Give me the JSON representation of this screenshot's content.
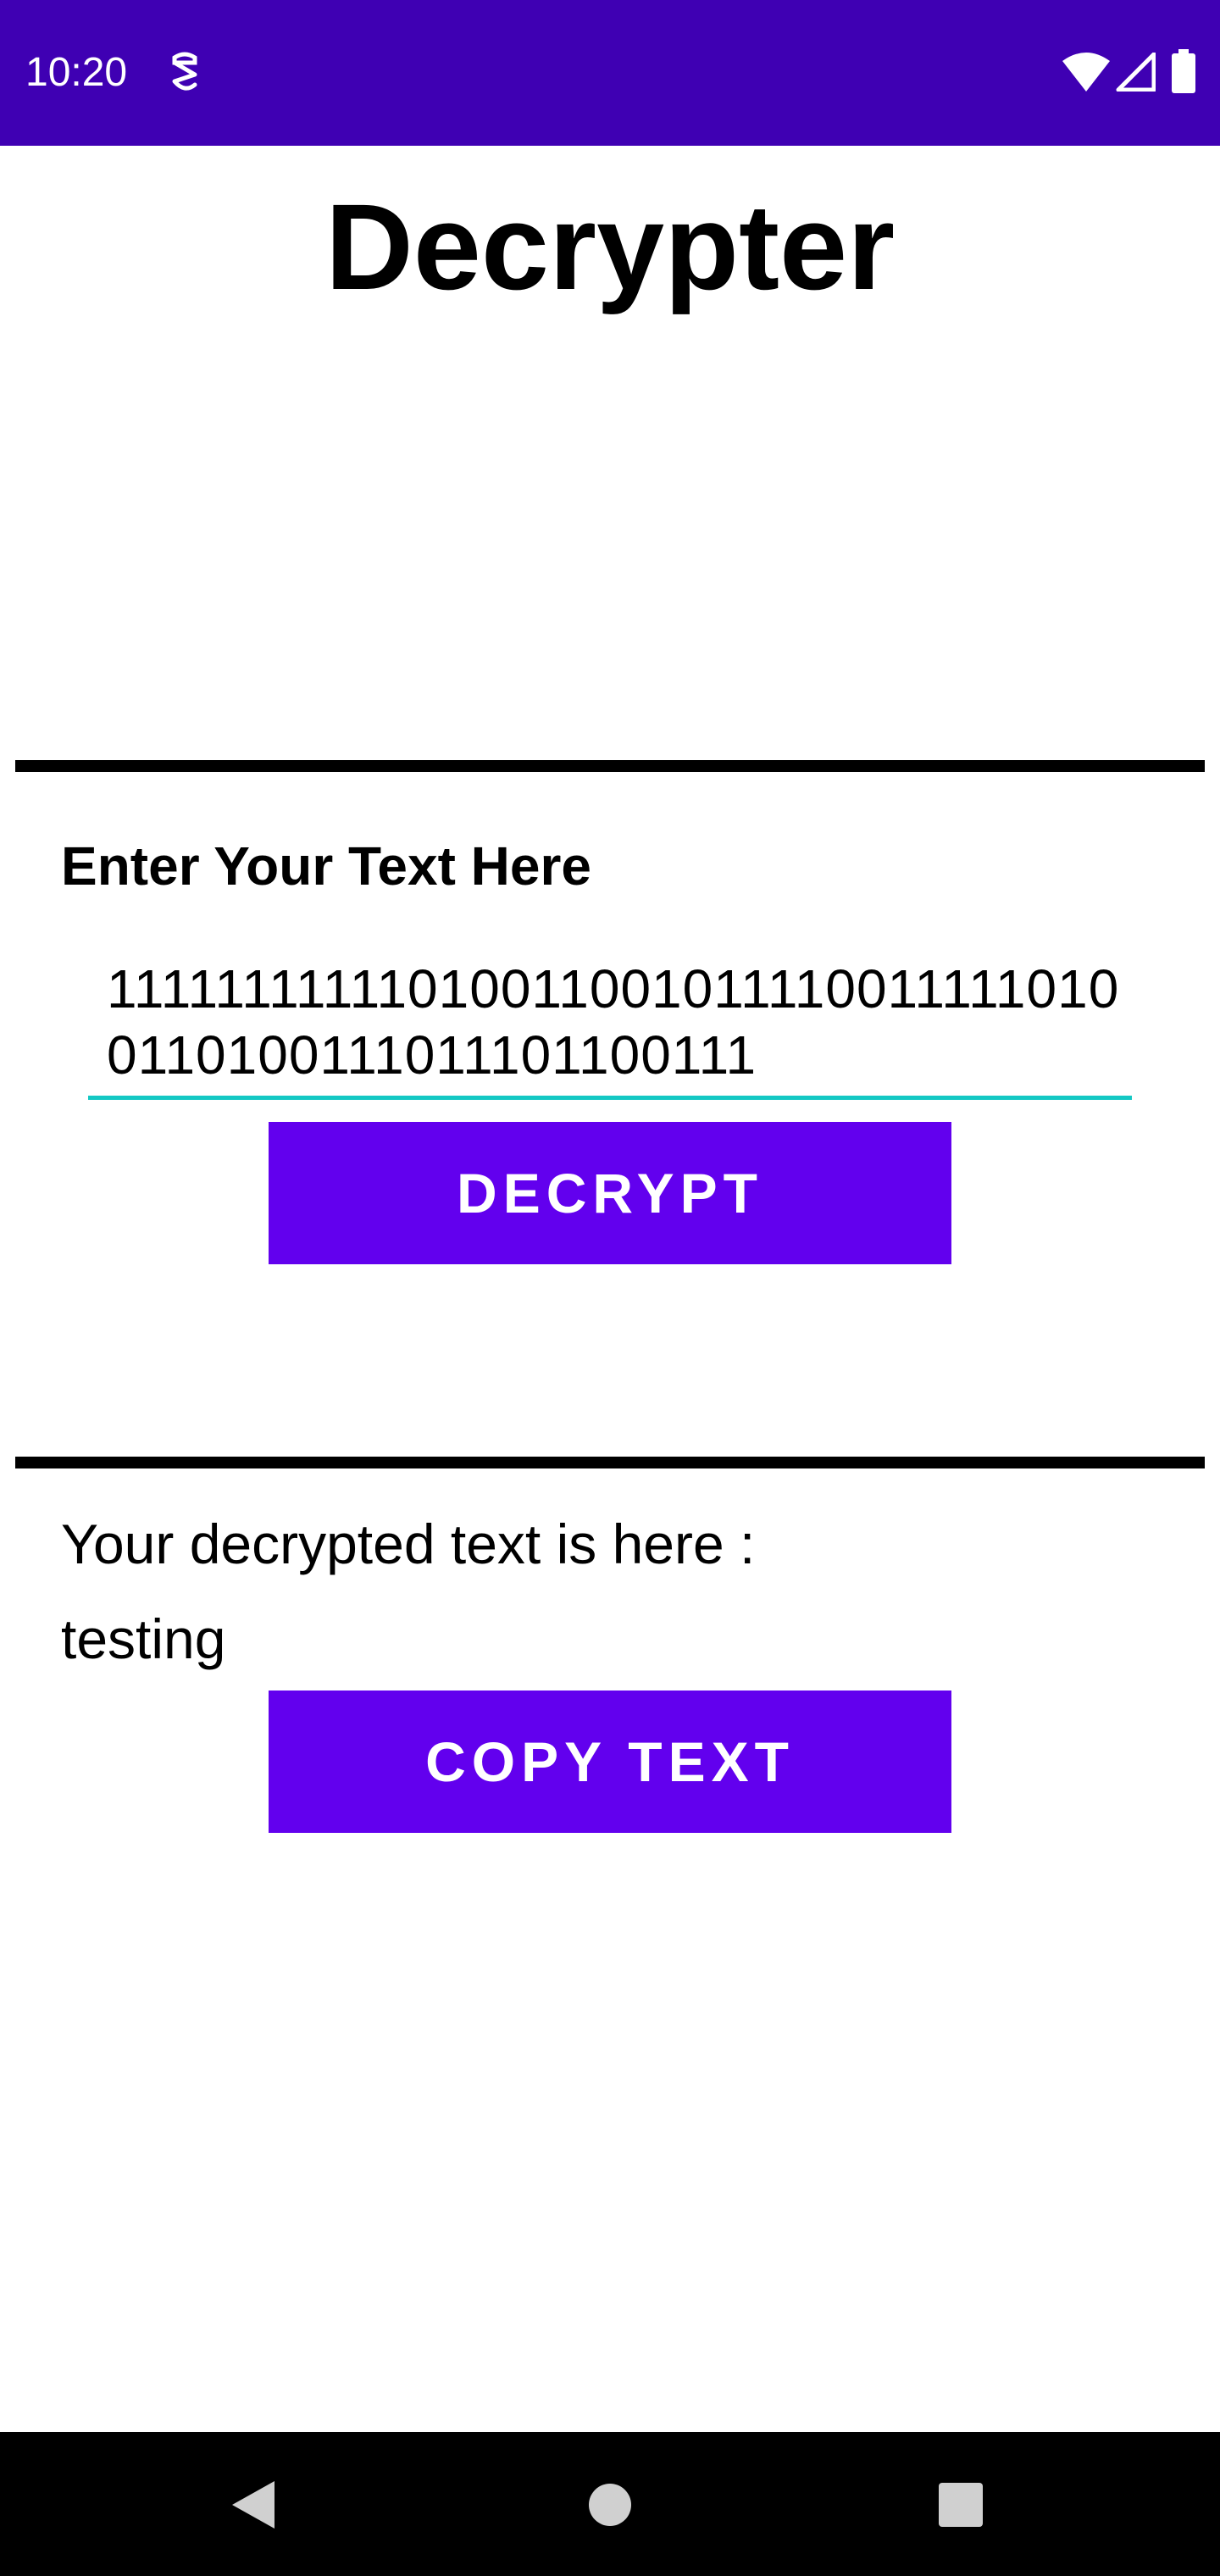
{
  "status_bar": {
    "time": "10:20",
    "color": "#3f00b3",
    "icons": [
      "notification-icon",
      "wifi-icon",
      "signal-icon",
      "battery-icon"
    ]
  },
  "app": {
    "title": "Decrypter",
    "input_label": "Enter Your Text Here",
    "input_value": "111111111110100110010111100111110100110100111011101100111",
    "decrypt_button": "Decrypt",
    "result_label": "Your decrypted text is here :",
    "result_value": "testing",
    "copy_button": "Copy Text",
    "accent_color": "#6200ee",
    "input_underline_color": "#14c8c4"
  },
  "nav_bar": {
    "icons": [
      "back-icon",
      "home-icon",
      "recents-icon"
    ]
  }
}
